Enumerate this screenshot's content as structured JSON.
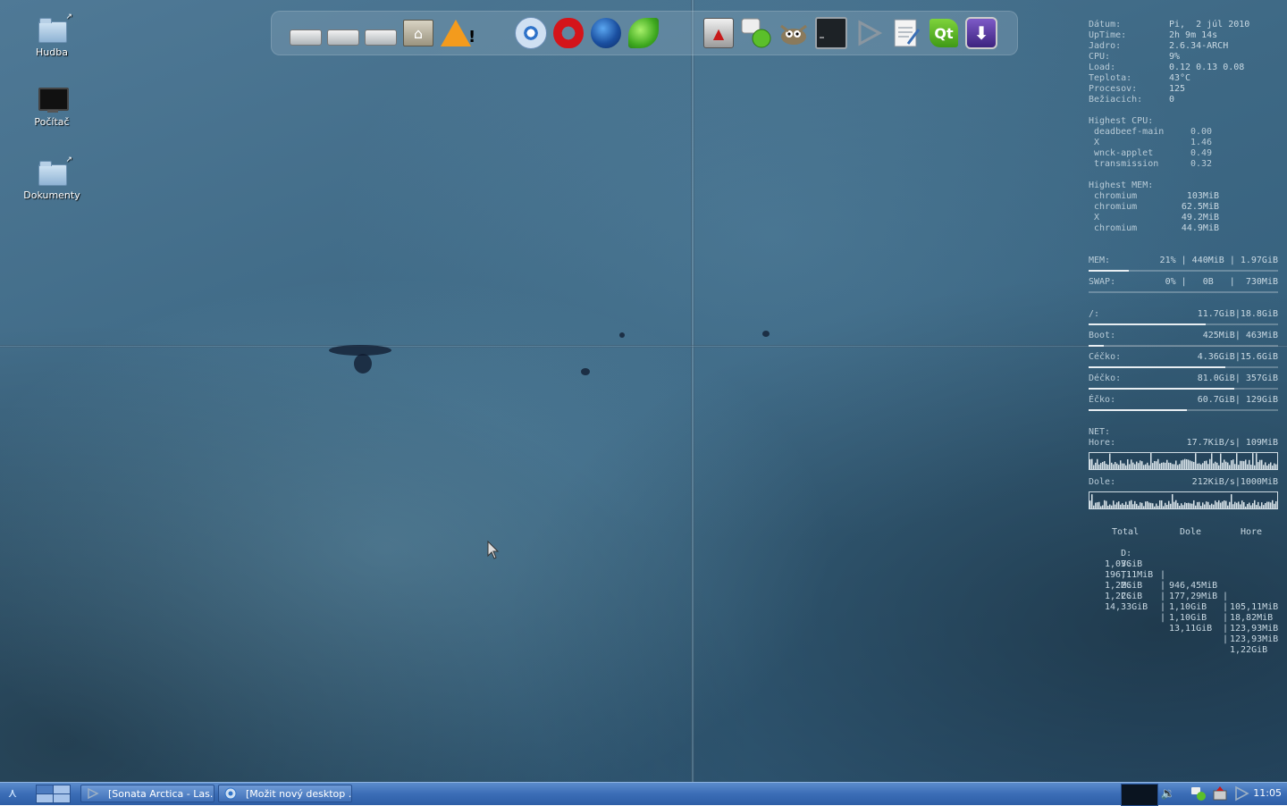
{
  "desktop_icons": [
    {
      "name": "folder",
      "label": "Hudba",
      "link": "↗"
    },
    {
      "name": "computer",
      "label": "Počítač"
    },
    {
      "name": "folder",
      "label": "Dokumenty",
      "link": "↗"
    }
  ],
  "dock": {
    "items": [
      "drive-icon",
      "drive-icon",
      "drive-icon",
      "home-folder-icon",
      "warning-icon",
      "chromium-icon",
      "opera-icon",
      "firefox-icon",
      "miro-icon",
      "transmission-icon",
      "pidgin-icon",
      "gimp-icon",
      "terminal-icon",
      "deadbeef-icon",
      "text-editor-icon",
      "qt-creator-icon",
      "download-icon"
    ],
    "qt_text": "Qt"
  },
  "conky": {
    "system": [
      {
        "label": "Dátum:",
        "value": "Pi,  2 júl 2010"
      },
      {
        "label": "UpTime:",
        "value": "2h 9m 14s"
      },
      {
        "label": "Jadro:",
        "value": "2.6.34-ARCH"
      },
      {
        "label": "CPU:",
        "value": "9%"
      },
      {
        "label": "Load:",
        "value": "0.12 0.13 0.08"
      },
      {
        "label": "Teplota:",
        "value": "43°C"
      },
      {
        "label": "Procesov:",
        "value": "125"
      },
      {
        "label": "Bežiacich:",
        "value": "0"
      }
    ],
    "highest_cpu": {
      "title": "Highest CPU:",
      "rows": [
        {
          "name": "deadbeef-main",
          "value": "0.00"
        },
        {
          "name": "X",
          "value": "1.46"
        },
        {
          "name": "wnck-applet",
          "value": "0.49"
        },
        {
          "name": "transmission",
          "value": "0.32"
        }
      ]
    },
    "highest_mem": {
      "title": "Highest MEM:",
      "rows": [
        {
          "name": "chromium",
          "value": "103MiB"
        },
        {
          "name": "chromium",
          "value": "62.5MiB"
        },
        {
          "name": "X",
          "value": "49.2MiB"
        },
        {
          "name": "chromium",
          "value": "44.9MiB"
        }
      ]
    },
    "mem": {
      "label": "MEM:",
      "value": "21% | 440MiB | 1.97GiB",
      "fill": 0.21
    },
    "swap": {
      "label": "SWAP:",
      "value": "0% |   0B   |  730MiB",
      "fill": 0.0
    },
    "disks": [
      {
        "label": "/:",
        "value": "11.7GiB|18.8GiB",
        "fill": 0.62
      },
      {
        "label": "Boot:",
        "value": "425MiB| 463MiB",
        "fill": 0.08
      },
      {
        "label": "Céčko:",
        "value": "4.36GiB|15.6GiB",
        "fill": 0.72
      },
      {
        "label": "Déčko:",
        "value": "81.0GiB| 357GiB",
        "fill": 0.77
      },
      {
        "label": "Éčko:",
        "value": "60.7GiB| 129GiB",
        "fill": 0.52
      }
    ],
    "net": {
      "title": "NET:",
      "up": {
        "label": "Hore:",
        "value": "17.7KiB/s| 109MiB"
      },
      "down": {
        "label": "Dole:",
        "value": "212KiB/s|1000MiB"
      }
    },
    "traffic_table": {
      "headers": [
        "Total",
        "Dole",
        "Hore"
      ],
      "rows": [
        {
          "key": "D:",
          "total": "1,03GiB",
          "dole": "946,45MiB",
          "hore": "105,11MiB"
        },
        {
          "key": "V:",
          "total": "196,11MiB",
          "dole": "177,29MiB",
          "hore": "18,82MiB"
        },
        {
          "key": "T:",
          "total": "1,22GiB",
          "dole": "1,10GiB",
          "hore": "123,93MiB"
        },
        {
          "key": "M:",
          "total": "1,22GiB",
          "dole": "1,10GiB",
          "hore": "123,93MiB"
        },
        {
          "key": "C:",
          "total": "14,33GiB",
          "dole": "13,11GiB",
          "hore": "1,22GiB"
        }
      ]
    }
  },
  "taskbar": {
    "tasks": [
      {
        "label": "[Sonata Arctica - Las..."
      },
      {
        "label": "[Možit nový desktop ..."
      }
    ],
    "clock": "11:05"
  },
  "colors": {
    "taskbar": "#3b6db6",
    "conky_text": "#c9d9e3",
    "wallpaper": "#3e6985"
  }
}
